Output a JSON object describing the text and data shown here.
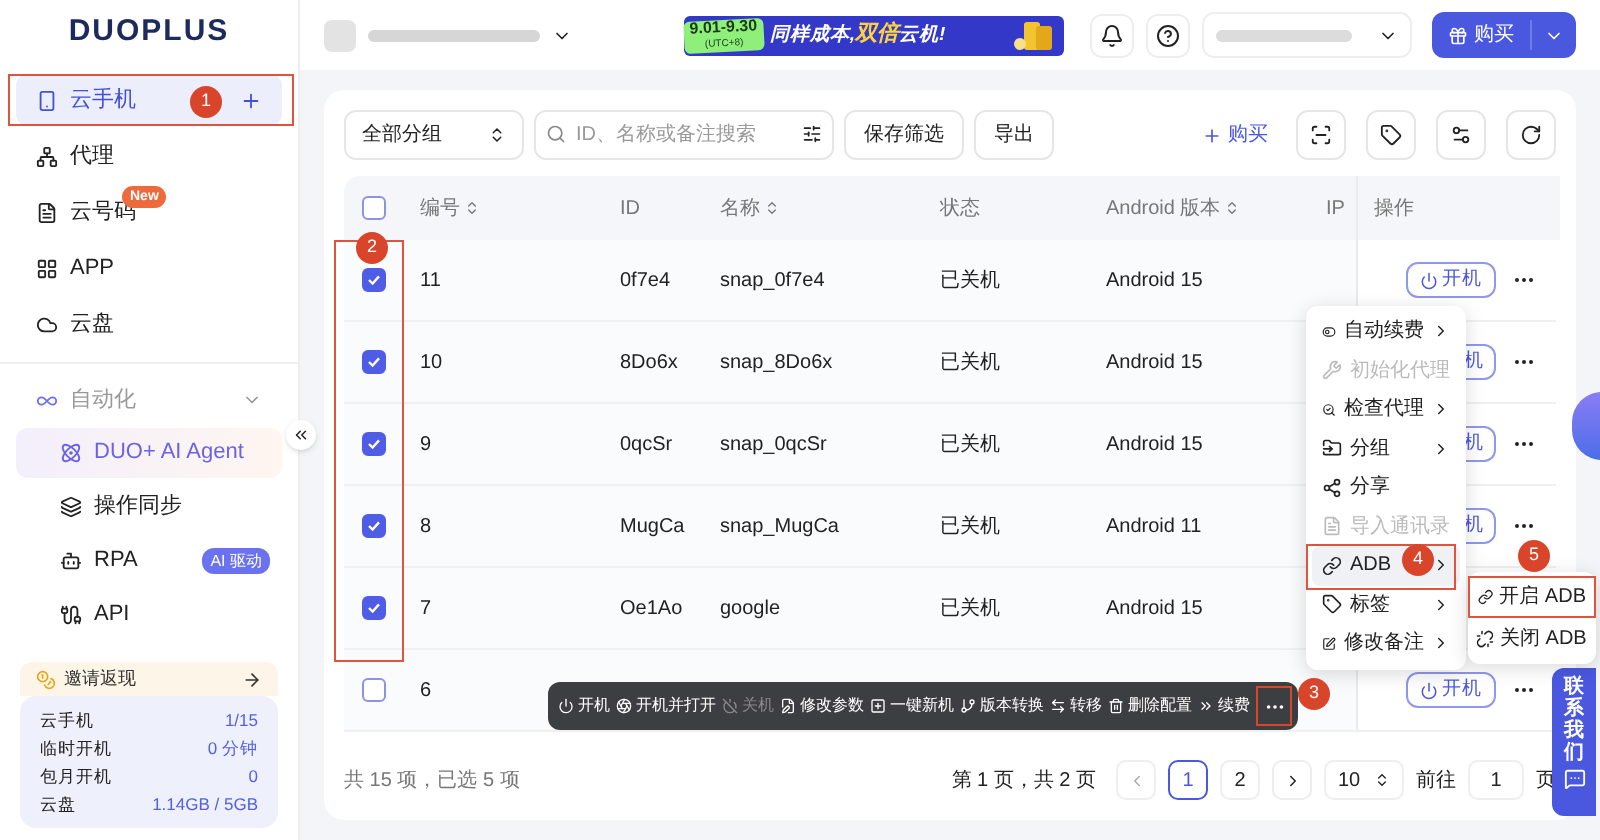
{
  "sidebar": {
    "logo": "DUOPLUS",
    "nav": [
      {
        "label": "云手机",
        "selected": true
      },
      {
        "label": "代理",
        "selected": false
      },
      {
        "label": "云号码",
        "selected": false,
        "badge": "New"
      },
      {
        "label": "APP",
        "selected": false
      },
      {
        "label": "云盘",
        "selected": false
      }
    ],
    "section": {
      "label": "自动化",
      "expanded": true,
      "children": [
        {
          "label": "DUO+ AI Agent",
          "selected": true
        },
        {
          "label": "操作同步",
          "selected": false
        },
        {
          "label": "RPA",
          "selected": false,
          "badge": "AI 驱动"
        },
        {
          "label": "API",
          "selected": false
        }
      ]
    },
    "invite": "邀请返现",
    "stats": [
      {
        "label": "云手机",
        "value": "1/15"
      },
      {
        "label": "临时开机",
        "value": "0 分钟"
      },
      {
        "label": "包月开机",
        "value": "0"
      },
      {
        "label": "云盘",
        "value": "1.14GB / 5GB"
      }
    ]
  },
  "header": {
    "banner": {
      "dates": "9.01-9.30",
      "timezone": "(UTC+8)",
      "slogan_start": "同样成本,",
      "slogan_highlight": "双倍",
      "slogan_end": "云机!"
    },
    "buy_button": "购买"
  },
  "toolbar": {
    "group_select": "全部分组",
    "search": {
      "placeholder": "ID、名称或备注搜索"
    },
    "buttons": [
      "保存筛选",
      "导出"
    ],
    "buy_link": "购买"
  },
  "table": {
    "columns": [
      {
        "label": "编号",
        "sortable": true
      },
      {
        "label": "ID",
        "sortable": false
      },
      {
        "label": "名称",
        "sortable": true
      },
      {
        "label": "状态",
        "sortable": false
      },
      {
        "label": "Android 版本",
        "sortable": true
      },
      {
        "label": "IP",
        "sortable": false
      },
      {
        "label": "操作",
        "sortable": false
      }
    ],
    "rows": [
      {
        "checked": true,
        "number": "11",
        "id": "0f7e4",
        "name": "snap_0f7e4",
        "status": "已关机",
        "android": "Android 15",
        "action": {
          "label": "开机",
          "clipped": false
        }
      },
      {
        "checked": true,
        "number": "10",
        "id": "8Do6x",
        "name": "snap_8Do6x",
        "status": "已关机",
        "android": "Android 15",
        "action": {
          "label": "机",
          "clipped": true
        }
      },
      {
        "checked": true,
        "number": "9",
        "id": "0qcSr",
        "name": "snap_0qcSr",
        "status": "已关机",
        "android": "Android 15",
        "action": {
          "label": "机",
          "clipped": true
        }
      },
      {
        "checked": true,
        "number": "8",
        "id": "MugCa",
        "name": "snap_MugCa",
        "status": "已关机",
        "android": "Android 11",
        "action": {
          "label": "机",
          "clipped": true
        }
      },
      {
        "checked": true,
        "number": "7",
        "id": "Oe1Ao",
        "name": "google",
        "status": "已关机",
        "android": "Android 15"
      },
      {
        "checked": false,
        "number": "6",
        "action": {
          "label": "开机",
          "clipped": false
        }
      }
    ],
    "all_checked": false
  },
  "batch_bar": [
    {
      "label": "开机",
      "disabled": false
    },
    {
      "label": "开机并打开",
      "disabled": false
    },
    {
      "label": "关机",
      "disabled": true
    },
    {
      "label": "修改参数",
      "disabled": false
    },
    {
      "label": "一键新机",
      "disabled": false
    },
    {
      "label": "版本转换",
      "disabled": false
    },
    {
      "label": "转移",
      "disabled": false
    },
    {
      "label": "删除配置",
      "disabled": false
    },
    {
      "label": "续费",
      "disabled": false
    }
  ],
  "context_menu": [
    {
      "label": "自动续费",
      "disabled": false,
      "submenu": true,
      "highlighted": false
    },
    {
      "label": "初始化代理",
      "disabled": true,
      "submenu": false,
      "highlighted": false
    },
    {
      "label": "检查代理",
      "disabled": false,
      "submenu": true,
      "highlighted": false
    },
    {
      "label": "分组",
      "disabled": false,
      "submenu": true,
      "highlighted": false
    },
    {
      "label": "分享",
      "disabled": false,
      "submenu": false,
      "highlighted": false
    },
    {
      "label": "导入通讯录",
      "disabled": true,
      "submenu": false,
      "highlighted": false
    },
    {
      "label": "ADB",
      "disabled": false,
      "submenu": true,
      "highlighted": true
    },
    {
      "label": "标签",
      "disabled": false,
      "submenu": true,
      "highlighted": false
    },
    {
      "label": "修改备注",
      "disabled": false,
      "submenu": true,
      "highlighted": false
    }
  ],
  "submenu": [
    {
      "label": "开启 ADB"
    },
    {
      "label": "关闭 ADB"
    }
  ],
  "footer": {
    "summary": "共 15 项，已选 5 项",
    "page_info": "第 1 页，共 2 页",
    "pages": [
      {
        "label": "1",
        "selected": true
      },
      {
        "label": "2",
        "selected": false
      }
    ],
    "page_size": "10",
    "goto_label": "前往",
    "goto_value": "1",
    "goto_suffix": "页"
  },
  "contact": "联系我们",
  "annotations": [
    {
      "number": "1"
    },
    {
      "number": "2"
    },
    {
      "number": "3"
    },
    {
      "number": "4"
    },
    {
      "number": "5"
    }
  ]
}
